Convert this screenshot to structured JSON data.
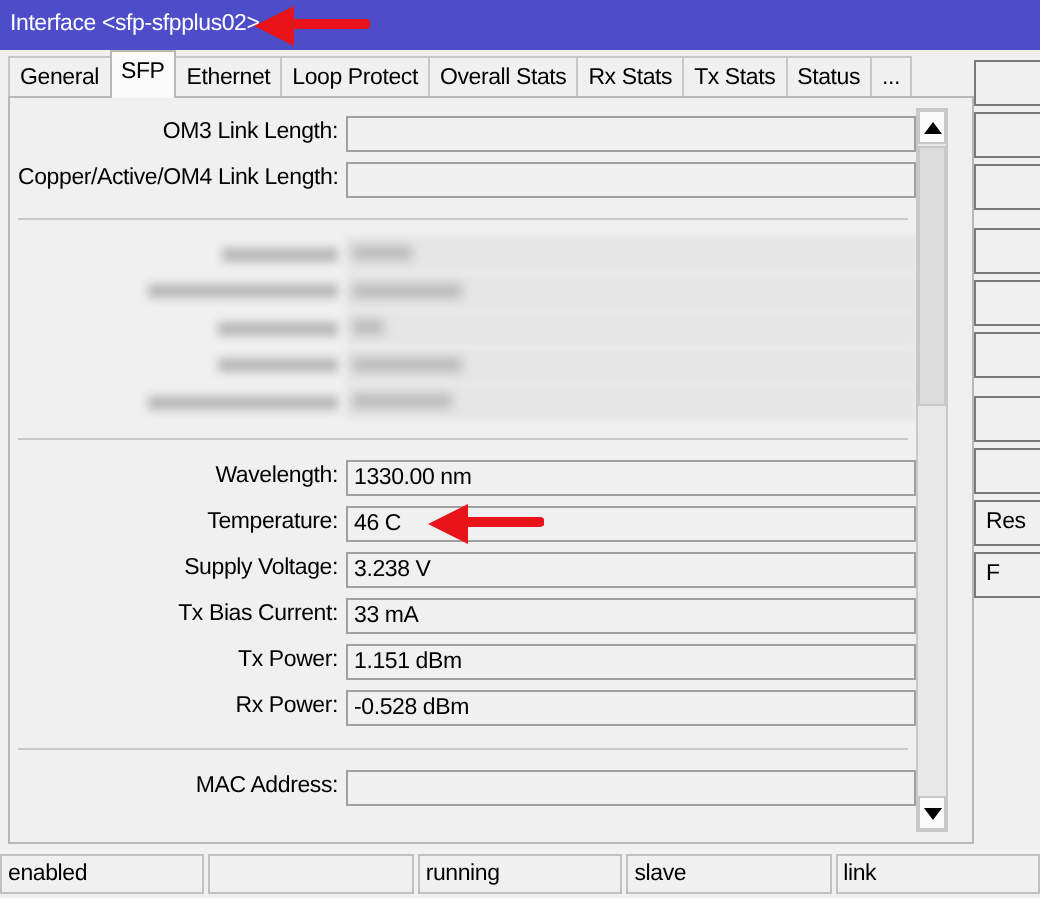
{
  "window": {
    "title": "Interface <sfp-sfpplus02>",
    "arrow": true
  },
  "tabs": [
    {
      "label": "General",
      "selected": false
    },
    {
      "label": "SFP",
      "selected": true
    },
    {
      "label": "Ethernet",
      "selected": false
    },
    {
      "label": "Loop Protect",
      "selected": false
    },
    {
      "label": "Overall Stats",
      "selected": false
    },
    {
      "label": "Rx Stats",
      "selected": false
    },
    {
      "label": "Tx Stats",
      "selected": false
    },
    {
      "label": "Status",
      "selected": false
    },
    {
      "label": "...",
      "selected": false
    }
  ],
  "rows": [
    {
      "kind": "field",
      "label": "OM3 Link Length:"
    },
    {
      "kind": "field",
      "label": "Copper/Active/OM4 Link Length:"
    },
    {
      "kind": "separator"
    },
    {
      "kind": "blurred"
    },
    {
      "kind": "blurred"
    },
    {
      "kind": "blurred"
    },
    {
      "kind": "blurred"
    },
    {
      "kind": "blurred"
    },
    {
      "kind": "separator"
    },
    {
      "kind": "field",
      "label": "Wavelength:",
      "value": "1330.00 nm"
    },
    {
      "kind": "field",
      "label": "Temperature:",
      "value": "46 C",
      "arrow": true
    },
    {
      "kind": "field",
      "label": "Supply Voltage:",
      "value": "3.238 V"
    },
    {
      "kind": "field",
      "label": "Tx Bias Current:",
      "value": "33 mA"
    },
    {
      "kind": "field",
      "label": "Tx Power:",
      "value": "1.151 dBm"
    },
    {
      "kind": "field",
      "label": "Rx Power:",
      "value": "-0.528 dBm"
    },
    {
      "kind": "separator"
    },
    {
      "kind": "field",
      "label": "MAC Address:"
    }
  ],
  "side_buttons": [
    {
      "kind": "blank"
    },
    {
      "kind": "blank"
    },
    {
      "kind": "blank"
    },
    {
      "kind": "blank"
    },
    {
      "kind": "blank"
    },
    {
      "kind": "blank"
    },
    {
      "kind": "blank"
    },
    {
      "kind": "blank"
    },
    {
      "kind": "text",
      "label": "Res"
    },
    {
      "kind": "text",
      "label": "F"
    }
  ],
  "status_bar": [
    {
      "kind": "text",
      "text": "enabled"
    },
    {
      "kind": "blank"
    },
    {
      "kind": "text",
      "text": "running"
    },
    {
      "kind": "text",
      "text": "slave"
    },
    {
      "kind": "text",
      "text": "link"
    }
  ]
}
